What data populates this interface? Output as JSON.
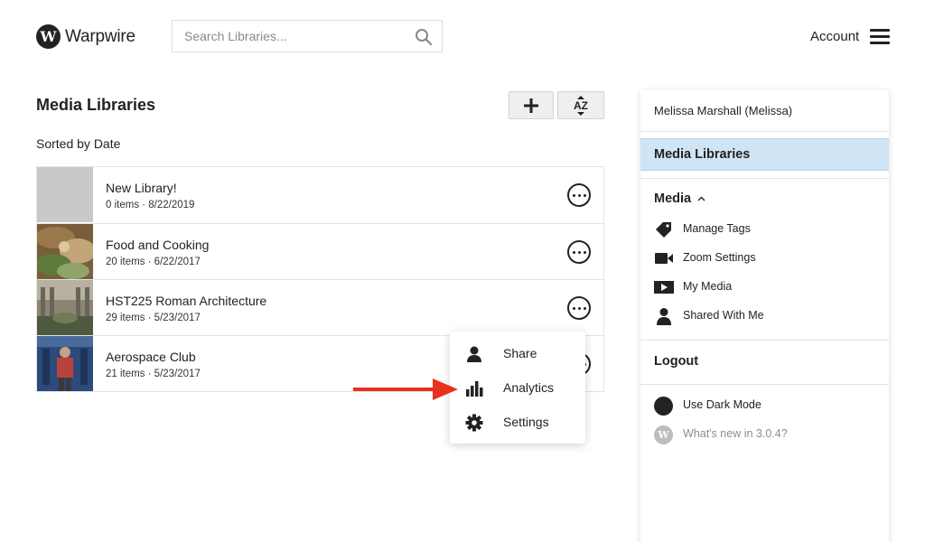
{
  "header": {
    "logo_letter": "W",
    "logo_text": "Warpwire",
    "search_placeholder": "Search Libraries...",
    "account_label": "Account"
  },
  "main": {
    "title": "Media Libraries",
    "sorted_label": "Sorted by Date",
    "sort_button_label": "AZ",
    "libraries": [
      {
        "name": "New Library!",
        "meta": "0 items · 8/22/2019"
      },
      {
        "name": "Food and Cooking",
        "meta": "20 items · 6/22/2017"
      },
      {
        "name": "HST225 Roman Architecture",
        "meta": "29 items · 5/23/2017"
      },
      {
        "name": "Aerospace Club",
        "meta": "21 items · 5/23/2017"
      }
    ]
  },
  "popup_menu": {
    "items": [
      {
        "label": "Share",
        "icon": "person-icon"
      },
      {
        "label": "Analytics",
        "icon": "bar-chart-icon"
      },
      {
        "label": "Settings",
        "icon": "gear-icon"
      }
    ]
  },
  "annotation": {
    "arrow_color": "#e8321e"
  },
  "side_panel": {
    "user_name": "Melissa Marshall (Melissa)",
    "active_item": "Media Libraries",
    "media_section": "Media",
    "media_items": [
      {
        "label": "Manage Tags",
        "icon": "tag-icon"
      },
      {
        "label": "Zoom Settings",
        "icon": "video-camera-icon"
      },
      {
        "label": "My Media",
        "icon": "play-icon"
      },
      {
        "label": "Shared With Me",
        "icon": "person-icon"
      }
    ],
    "logout_label": "Logout",
    "dark_mode_label": "Use Dark Mode",
    "whats_new_label": "What's new in 3.0.4?",
    "active_color": "#cfe4f5"
  }
}
